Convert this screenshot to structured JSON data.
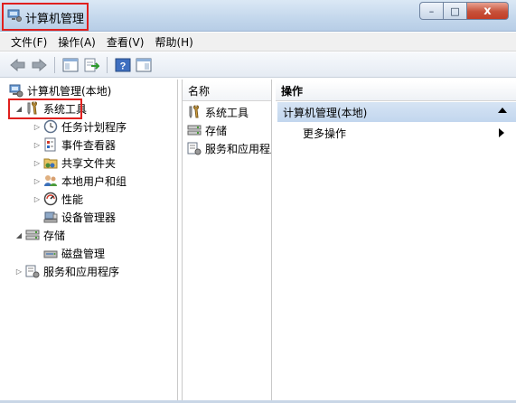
{
  "window": {
    "title": "计算机管理"
  },
  "title_buttons": {
    "minimize": "–",
    "maximize": "□",
    "close": "x"
  },
  "menu": [
    "文件(F)",
    "操作(A)",
    "查看(V)",
    "帮助(H)"
  ],
  "toolbar_icons": [
    "back-arrow-icon",
    "forward-arrow-icon",
    "show-hide-console-tree-icon",
    "export-list-icon",
    "help-icon",
    "show-hide-action-pane-icon"
  ],
  "tree": {
    "root": "计算机管理(本地)",
    "system_tools": "系统工具",
    "task_scheduler": "任务计划程序",
    "event_viewer": "事件查看器",
    "shared_folders": "共享文件夹",
    "local_users": "本地用户和组",
    "performance": "性能",
    "device_manager": "设备管理器",
    "storage": "存储",
    "disk_management": "磁盘管理",
    "services_apps": "服务和应用程序"
  },
  "middle": {
    "header": "名称",
    "items": [
      "系统工具",
      "存储",
      "服务和应用程序"
    ]
  },
  "actions": {
    "header": "操作",
    "section": "计算机管理(本地)",
    "item": "更多操作"
  },
  "colors": {
    "highlight_box": "#e0201e",
    "section_bg": "#c9dbf0"
  }
}
